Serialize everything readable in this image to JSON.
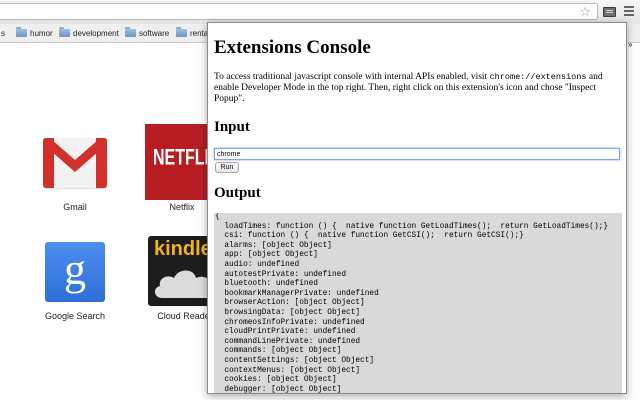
{
  "bookmarks_bar": {
    "items": [
      {
        "label": "s"
      },
      {
        "label": "humor"
      },
      {
        "label": "development"
      },
      {
        "label": "software"
      },
      {
        "label": "rental"
      }
    ],
    "overflow": "»"
  },
  "apps": [
    {
      "label": "Gmail"
    },
    {
      "label": "Netflix",
      "logo_text": "NETFLIX"
    },
    {
      "label": "Google Search",
      "logo_text": "g"
    },
    {
      "label": "Cloud Reader",
      "logo_text": "kindle"
    }
  ],
  "popup": {
    "title": "Extensions Console",
    "description_pre": "To access traditional javascript console with internal APIs enabled, visit ",
    "description_code": "chrome://extensions",
    "description_post": " and enable Developer Mode in the top right. Then, right click on this extension's icon and chose \"Inspect Popup\".",
    "input_heading": "Input",
    "input_value": "chrome",
    "run_label": "Run",
    "output_heading": "Output",
    "output_lines": [
      "{",
      "  loadTimes: function () {  native function GetLoadTimes();  return GetLoadTimes();}",
      "  csi: function () {  native function GetCSI();  return GetCSI();}",
      "  alarms: [object Object]",
      "  app: [object Object]",
      "  audio: undefined",
      "  autotestPrivate: undefined",
      "  bluetooth: undefined",
      "  bookmarkManagerPrivate: undefined",
      "  browserAction: [object Object]",
      "  browsingData: [object Object]",
      "  chromeosInfoPrivate: undefined",
      "  cloudPrintPrivate: undefined",
      "  commandLinePrivate: undefined",
      "  commands: [object Object]",
      "  contentSettings: [object Object]",
      "  contextMenus: [object Object]",
      "  cookies: [object Object]",
      "  debugger: [object Object]"
    ]
  },
  "icons": {
    "star": "star-icon",
    "extension": "extension-icon",
    "menu": "menu-icon",
    "folder": "folder-icon"
  },
  "colors": {
    "gmail_red": "#d1302b",
    "netflix_red": "#b81d24",
    "google_blue": "#3a7fe6",
    "kindle_orange": "#f3b21e",
    "output_bg": "#d9d9d9"
  }
}
